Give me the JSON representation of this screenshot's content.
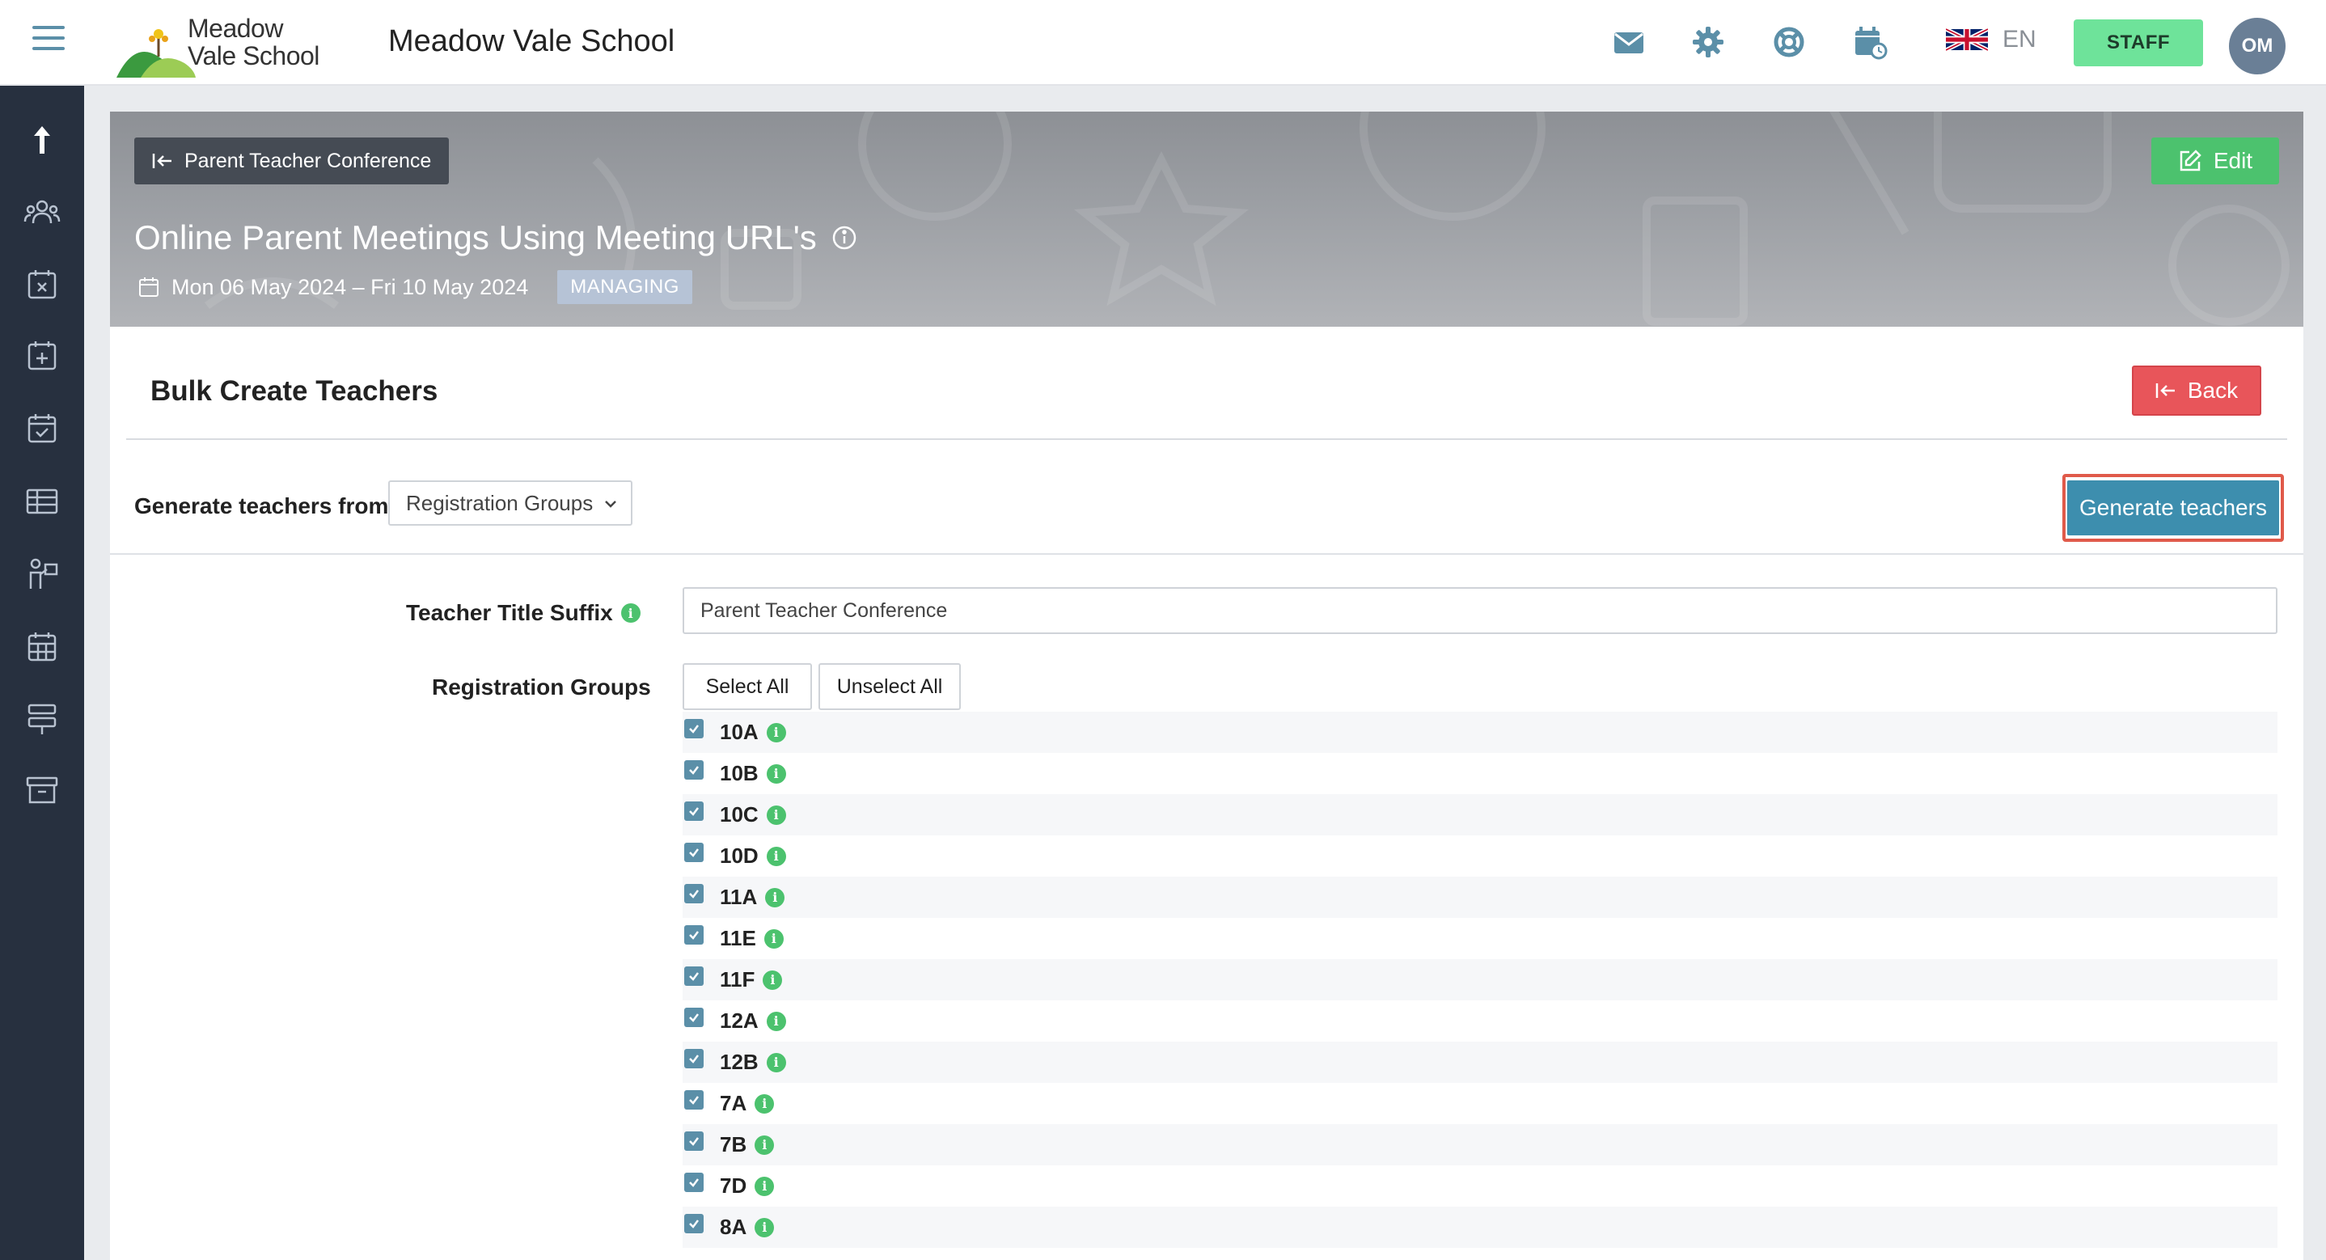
{
  "header": {
    "logo_line1": "Meadow",
    "logo_line2": "Vale School",
    "school_name": "Meadow Vale School",
    "language": "EN",
    "staff_label": "STAFF",
    "user_initials": "OM"
  },
  "banner": {
    "breadcrumb": "Parent Teacher Conference",
    "edit_label": "Edit",
    "title": "Online Parent Meetings Using Meeting URL's",
    "date_range": "Mon 06 May 2024 – Fri 10 May 2024",
    "badge": "MANAGING"
  },
  "section": {
    "title": "Bulk Create Teachers",
    "back_label": "Back",
    "generate_from_label": "Generate teachers from:",
    "generate_from_value": "Registration Groups",
    "generate_button": "Generate teachers"
  },
  "form": {
    "suffix_label": "Teacher Title Suffix",
    "suffix_value": "Parent Teacher Conference",
    "groups_label": "Registration Groups",
    "select_all": "Select All",
    "unselect_all": "Unselect All",
    "groups": [
      {
        "name": "10A",
        "checked": true
      },
      {
        "name": "10B",
        "checked": true
      },
      {
        "name": "10C",
        "checked": true
      },
      {
        "name": "10D",
        "checked": true
      },
      {
        "name": "11A",
        "checked": true
      },
      {
        "name": "11E",
        "checked": true
      },
      {
        "name": "11F",
        "checked": true
      },
      {
        "name": "12A",
        "checked": true
      },
      {
        "name": "12B",
        "checked": true
      },
      {
        "name": "7A",
        "checked": true
      },
      {
        "name": "7B",
        "checked": true
      },
      {
        "name": "7D",
        "checked": true
      },
      {
        "name": "8A",
        "checked": true
      }
    ]
  },
  "icons": {
    "top": [
      "mail-icon",
      "gear-icon",
      "lifebuoy-icon",
      "calendar-clock-icon",
      "uk-flag-icon"
    ],
    "sidebar": [
      "upload-arrow-icon",
      "people-icon",
      "calendar-x-icon",
      "calendar-plus-icon",
      "calendar-check-icon",
      "table-icon",
      "presenter-icon",
      "calendar-grid-icon",
      "signpost-icon",
      "archive-icon"
    ]
  },
  "colors": {
    "sidebar": "#27303f",
    "accent": "#5b8fa8",
    "staff_green": "#6ee39a",
    "edit_green": "#4cc26e",
    "back_red": "#e8555a",
    "generate_blue": "#3d8eae",
    "highlight_red": "#e05a4a"
  }
}
